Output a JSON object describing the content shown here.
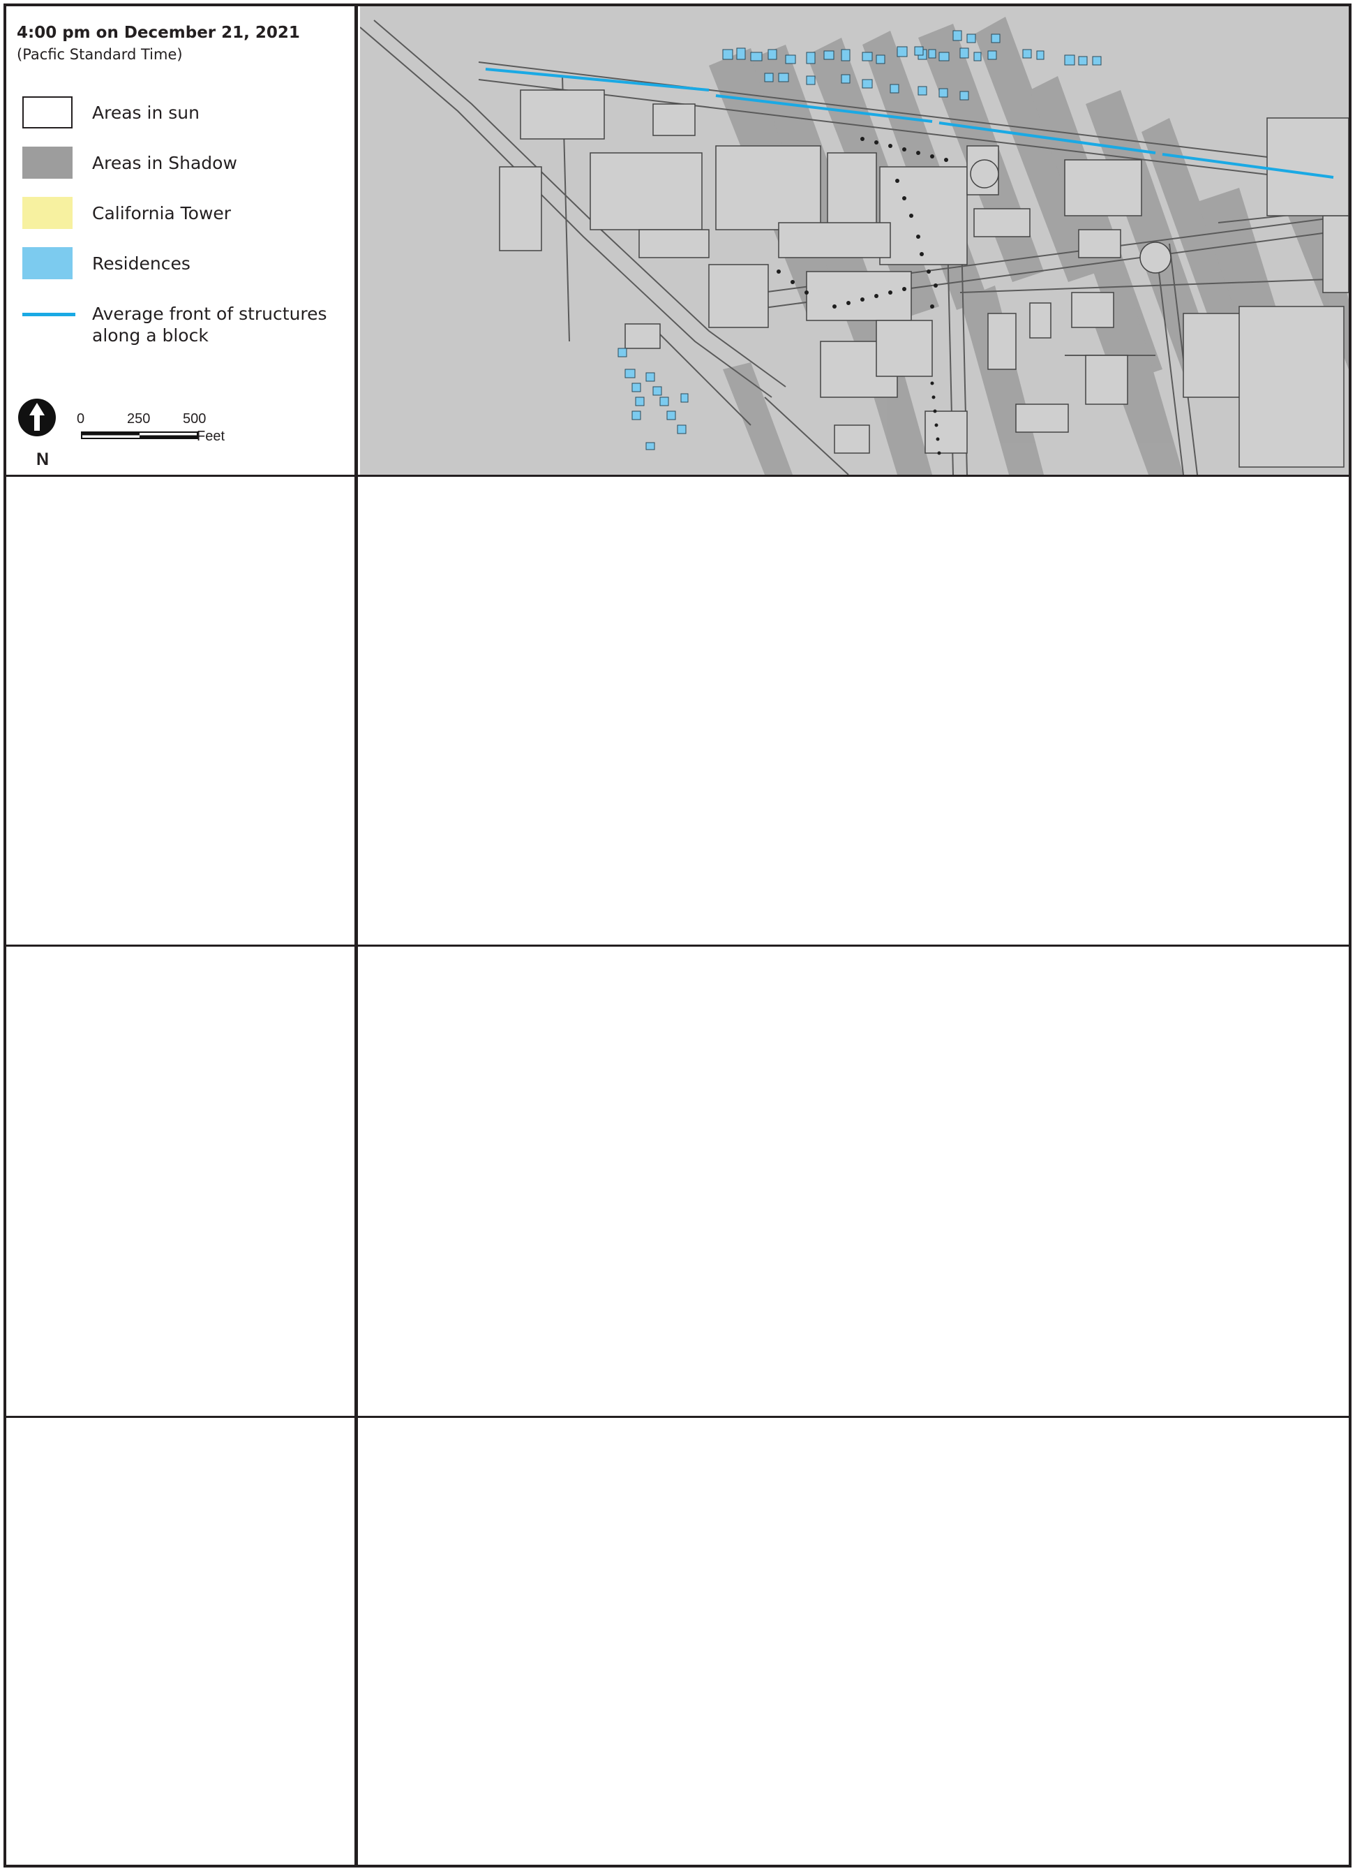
{
  "legend": {
    "title": "4:00 pm on December 21, 2021",
    "subtitle": "(Pacfic Standard Time)",
    "items": [
      {
        "label": "Areas in sun",
        "color": "#ffffff"
      },
      {
        "label": "Areas in Shadow",
        "color": "#9d9d9d"
      },
      {
        "label": "California Tower",
        "color": "#f7f1a0"
      },
      {
        "label": "Residences",
        "color": "#7ccbef"
      },
      {
        "label": "Average front of structures\nalong a block",
        "color": "#1aa9e4"
      }
    ]
  },
  "scale_bar": {
    "ticks": [
      "0",
      "250",
      "500"
    ],
    "unit": "Feet",
    "north_label": "N"
  },
  "colors": {
    "line": "#231f20",
    "sun": "#ffffff",
    "shadow": "#9d9d9d",
    "ground": "#c8c8c8",
    "residence": "#7ccbef",
    "frontage": "#1aa9e4"
  },
  "icons": [
    "north-arrow-icon"
  ]
}
